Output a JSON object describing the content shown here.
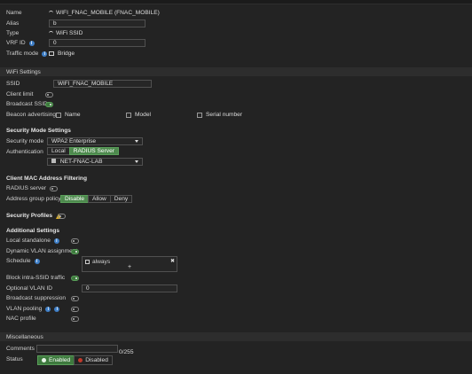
{
  "general": {
    "name_label": "Name",
    "name_value": "WIFI_FNAC_MOBILE (FNAC_MOBILE)",
    "alias_label": "Alias",
    "alias_value": "b",
    "type_label": "Type",
    "type_value": "WiFi SSID",
    "vrf_label": "VRF ID",
    "vrf_value": "0",
    "traffic_label": "Traffic mode",
    "traffic_value": "Bridge"
  },
  "wifi": {
    "section": "WiFi Settings",
    "ssid_label": "SSID",
    "ssid_value": "WIFI_FNAC_MOBILE",
    "client_limit_label": "Client limit",
    "broadcast_label": "Broadcast SSID",
    "beacon_label": "Beacon advertising",
    "beacon_name": "Name",
    "beacon_model": "Model",
    "beacon_serial": "Serial number"
  },
  "security": {
    "heading": "Security Mode Settings",
    "mode_label": "Security mode",
    "mode_value": "WPA2 Enterprise",
    "auth_label": "Authentication",
    "auth_local": "Local",
    "auth_radius": "RADIUS Server",
    "radius_value": "NET-FNAC-LAB"
  },
  "mac": {
    "heading": "Client MAC Address Filtering",
    "radius_label": "RADIUS server",
    "policy_label": "Address group policy",
    "policy_options": [
      "Disable",
      "Allow",
      "Deny"
    ]
  },
  "profiles": {
    "heading": "Security Profiles"
  },
  "additional": {
    "heading": "Additional Settings",
    "local_standalone": "Local standalone",
    "dynamic_vlan": "Dynamic VLAN assignment",
    "schedule_label": "Schedule",
    "schedule_value": "always",
    "schedule_add": "+",
    "schedule_remove": "✖",
    "block_intra": "Block intra-SSID traffic",
    "optional_vlan": "Optional VLAN ID",
    "optional_vlan_value": "0",
    "broadcast_suppression": "Broadcast suppression",
    "vlan_pooling": "VLAN pooling",
    "nac_profile": "NAC profile"
  },
  "misc": {
    "section": "Miscellaneous",
    "comments_label": "Comments",
    "comments_count": "0/255",
    "status_label": "Status",
    "enabled": "Enabled",
    "disabled": "Disabled"
  },
  "colors": {
    "accent_green": "#4e8a4e",
    "info_blue": "#3f7fc7",
    "warning": "#e0b020",
    "disabled_red": "#c0392b"
  }
}
